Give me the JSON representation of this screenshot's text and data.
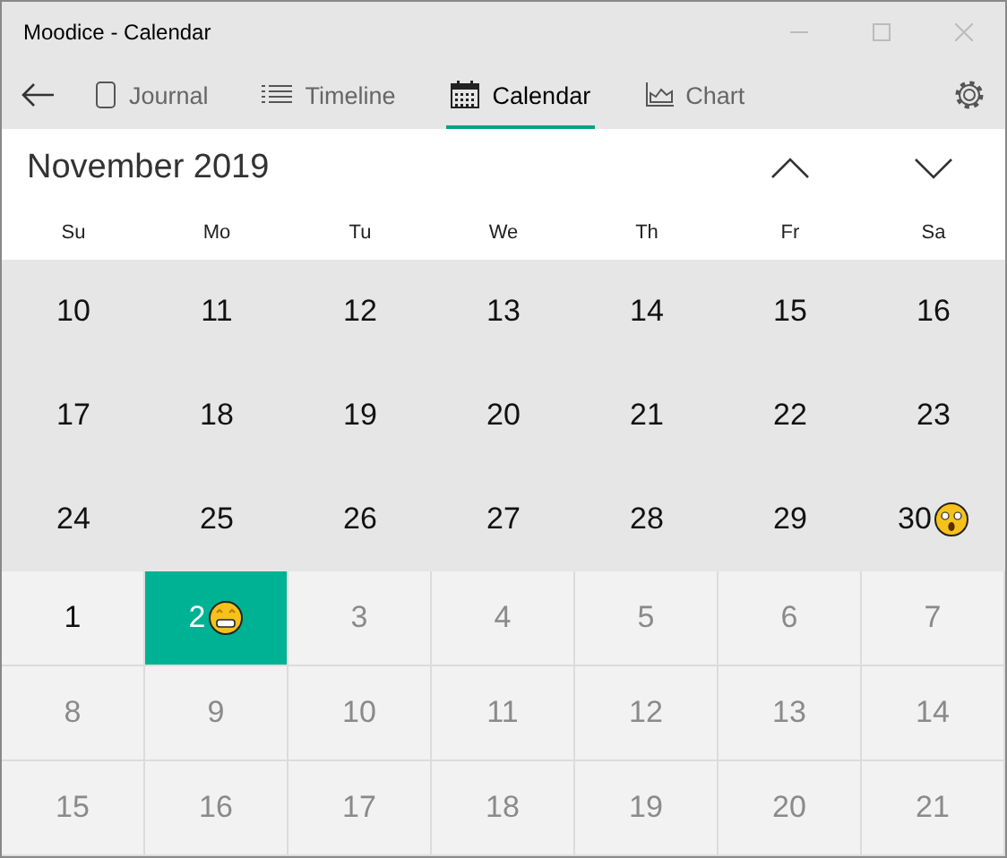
{
  "window": {
    "title": "Moodice - Calendar"
  },
  "tabs": [
    {
      "label": "Journal",
      "selected": false
    },
    {
      "label": "Timeline",
      "selected": false
    },
    {
      "label": "Calendar",
      "selected": true
    },
    {
      "label": "Chart",
      "selected": false
    }
  ],
  "month": "November 2019",
  "weekdays": [
    "Su",
    "Mo",
    "Tu",
    "We",
    "Th",
    "Fr",
    "Sa"
  ],
  "weeks": [
    {
      "kind": "current",
      "days": [
        {
          "label": "10",
          "muted": false,
          "selected": false
        },
        {
          "label": "11",
          "muted": false,
          "selected": false
        },
        {
          "label": "12",
          "muted": false,
          "selected": false
        },
        {
          "label": "13",
          "muted": false,
          "selected": false
        },
        {
          "label": "14",
          "muted": false,
          "selected": false
        },
        {
          "label": "15",
          "muted": false,
          "selected": false
        },
        {
          "label": "16",
          "muted": false,
          "selected": false
        }
      ]
    },
    {
      "kind": "current",
      "days": [
        {
          "label": "17",
          "muted": false,
          "selected": false
        },
        {
          "label": "18",
          "muted": false,
          "selected": false
        },
        {
          "label": "19",
          "muted": false,
          "selected": false
        },
        {
          "label": "20",
          "muted": false,
          "selected": false
        },
        {
          "label": "21",
          "muted": false,
          "selected": false
        },
        {
          "label": "22",
          "muted": false,
          "selected": false
        },
        {
          "label": "23",
          "muted": false,
          "selected": false
        }
      ]
    },
    {
      "kind": "current",
      "days": [
        {
          "label": "24",
          "muted": false,
          "selected": false
        },
        {
          "label": "25",
          "muted": false,
          "selected": false
        },
        {
          "label": "26",
          "muted": false,
          "selected": false
        },
        {
          "label": "27",
          "muted": false,
          "selected": false
        },
        {
          "label": "28",
          "muted": false,
          "selected": false
        },
        {
          "label": "29",
          "muted": false,
          "selected": false
        },
        {
          "label": "30",
          "muted": false,
          "selected": false,
          "kind": "shocked"
        }
      ]
    },
    {
      "kind": "next",
      "days": [
        {
          "label": "1",
          "muted": false,
          "selected": false
        },
        {
          "label": "2",
          "muted": false,
          "selected": true,
          "kind": "grin"
        },
        {
          "label": "3",
          "muted": true,
          "selected": false
        },
        {
          "label": "4",
          "muted": true,
          "selected": false
        },
        {
          "label": "5",
          "muted": true,
          "selected": false
        },
        {
          "label": "6",
          "muted": true,
          "selected": false
        },
        {
          "label": "7",
          "muted": true,
          "selected": false
        }
      ]
    },
    {
      "kind": "next",
      "days": [
        {
          "label": "8",
          "muted": true,
          "selected": false
        },
        {
          "label": "9",
          "muted": true,
          "selected": false
        },
        {
          "label": "10",
          "muted": true,
          "selected": false
        },
        {
          "label": "11",
          "muted": true,
          "selected": false
        },
        {
          "label": "12",
          "muted": true,
          "selected": false
        },
        {
          "label": "13",
          "muted": true,
          "selected": false
        },
        {
          "label": "14",
          "muted": true,
          "selected": false
        }
      ]
    },
    {
      "kind": "next",
      "days": [
        {
          "label": "15",
          "muted": true,
          "selected": false
        },
        {
          "label": "16",
          "muted": true,
          "selected": false
        },
        {
          "label": "17",
          "muted": true,
          "selected": false
        },
        {
          "label": "18",
          "muted": true,
          "selected": false
        },
        {
          "label": "19",
          "muted": true,
          "selected": false
        },
        {
          "label": "20",
          "muted": true,
          "selected": false
        },
        {
          "label": "21",
          "muted": true,
          "selected": false
        }
      ]
    }
  ]
}
